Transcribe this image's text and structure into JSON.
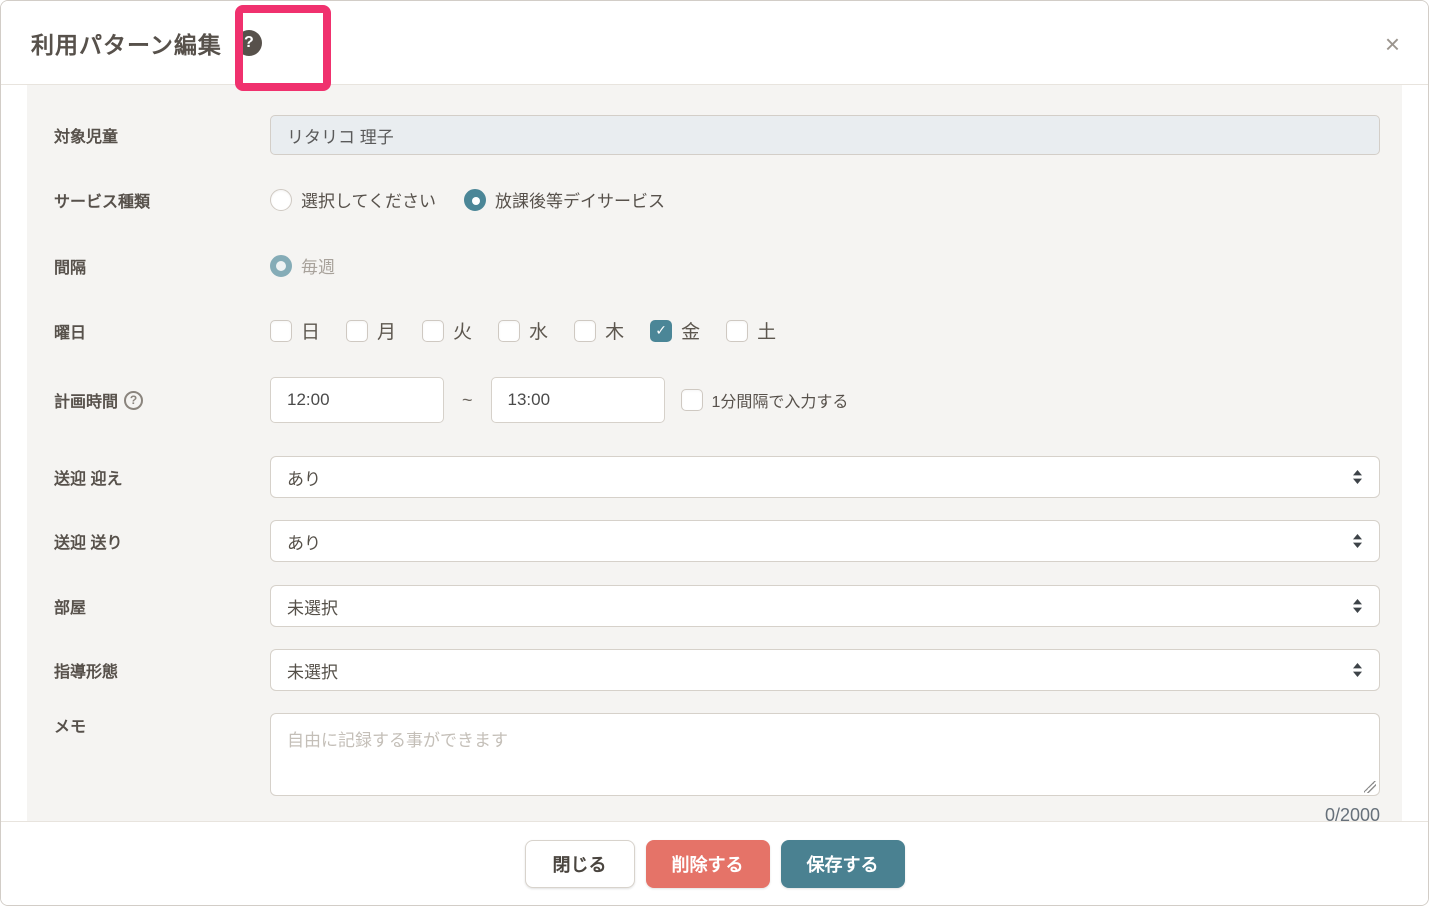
{
  "modal": {
    "title": "利用パターン編集",
    "title_help_glyph": "?",
    "close_glyph": "×"
  },
  "form": {
    "target_child": {
      "label": "対象児童",
      "value": "リタリコ 理子"
    },
    "service_type": {
      "label": "サービス種類",
      "options": [
        {
          "label": "選択してください",
          "selected": false
        },
        {
          "label": "放課後等デイサービス",
          "selected": true
        }
      ]
    },
    "interval": {
      "label": "間隔",
      "option_label": "毎週",
      "selected": true,
      "disabled": true
    },
    "weekday": {
      "label": "曜日",
      "days": [
        {
          "label": "日",
          "checked": false
        },
        {
          "label": "月",
          "checked": false
        },
        {
          "label": "火",
          "checked": false
        },
        {
          "label": "水",
          "checked": false
        },
        {
          "label": "木",
          "checked": false
        },
        {
          "label": "金",
          "checked": true
        },
        {
          "label": "土",
          "checked": false
        }
      ],
      "check_glyph": "✓"
    },
    "planned_time": {
      "label": "計画時間",
      "help_glyph": "?",
      "start": "12:00",
      "separator": "~",
      "end": "13:00",
      "minute_option": {
        "label": "1分間隔で入力する",
        "checked": false
      }
    },
    "pickup": {
      "label": "送迎 迎え",
      "value": "あり"
    },
    "dropoff": {
      "label": "送迎 送り",
      "value": "あり"
    },
    "room": {
      "label": "部屋",
      "value": "未選択"
    },
    "teaching_format": {
      "label": "指導形態",
      "value": "未選択"
    },
    "memo": {
      "label": "メモ",
      "placeholder": "自由に記録する事ができます",
      "counter": "0/2000"
    }
  },
  "footer": {
    "close_label": "閉じる",
    "delete_label": "削除する",
    "save_label": "保存する"
  },
  "colors": {
    "accent_teal": "#4b8697",
    "save_teal": "#4a8191",
    "delete_salmon": "#e57368",
    "annotation_pink": "#f0316e",
    "panel_gray": "#f5f4f2",
    "text_brown": "#57514b"
  }
}
